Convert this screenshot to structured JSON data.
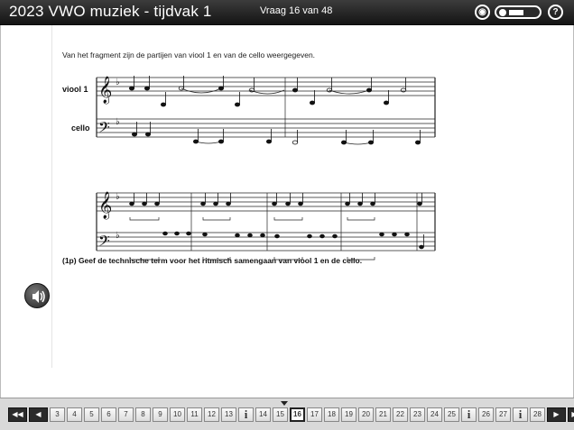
{
  "header": {
    "title": "2023 VWO muziek - tijdvak 1",
    "counter": "Vraag 16 van 48",
    "volume_label": "◀■▶",
    "icons": [
      "audio-icon",
      "volume-control",
      "help-icon"
    ],
    "help_label": "?"
  },
  "content": {
    "intro": "Van het fragment zijn de partijen van viool 1 en van de cello weergegeven.",
    "staff_labels": {
      "violin": "viool 1",
      "cello": "cello"
    },
    "question": "(1p) Geef de technische term voor het ritmisch samengaan van viool 1 en de cello."
  },
  "nav": {
    "first": "◀◀",
    "prev": "◀",
    "next": "▶",
    "last": "▶▶",
    "items": [
      "3",
      "4",
      "5",
      "6",
      "7",
      "8",
      "9",
      "10",
      "11",
      "12",
      "13",
      "i",
      "14",
      "15",
      "16",
      "17",
      "18",
      "19",
      "20",
      "21",
      "22",
      "23",
      "24",
      "25",
      "i",
      "26",
      "27",
      "i",
      "28"
    ],
    "current": "16"
  }
}
